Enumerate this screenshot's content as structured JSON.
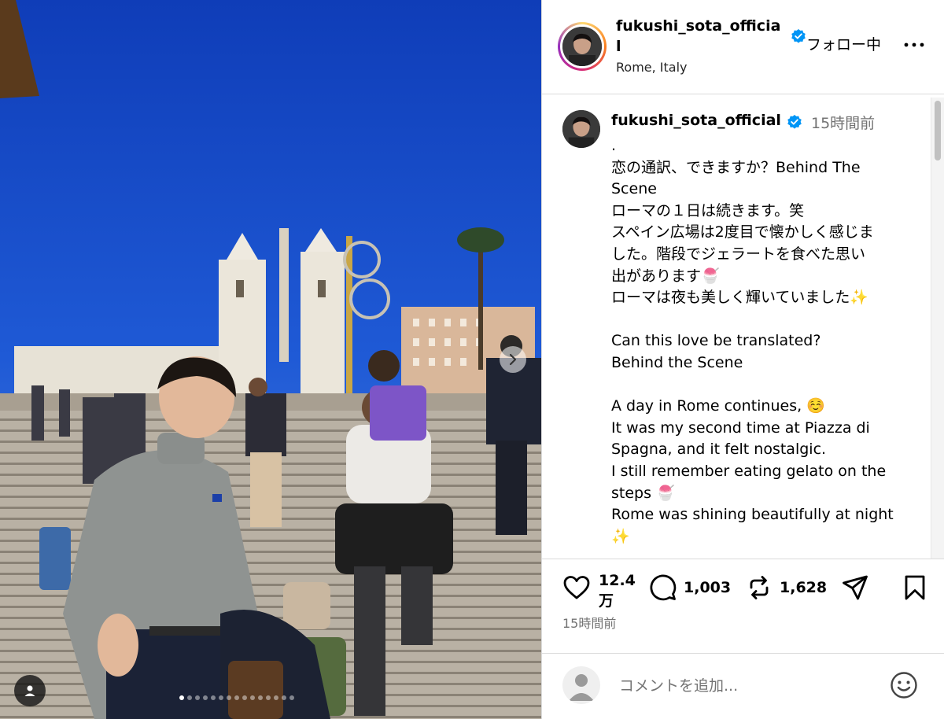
{
  "post": {
    "username": "fukushi_sota_official",
    "username_wrapped": "fukushi_sota_officia l",
    "follow_state": "フォロー中",
    "location": "Rome, Italy",
    "more_label": "•••"
  },
  "caption": {
    "username": "fukushi_sota_official",
    "time": "15時間前",
    "lines": [
      ".",
      "恋の通訳、できますか？Behind The",
      "Scene",
      "ローマの１日は続きます。笑",
      "スペイン広場は2度目で懐かしく感じま",
      "した。階段でジェラートを食べた思い",
      "出があります🍧",
      "ローマは夜も美しく輝いていました✨",
      "",
      "Can this love be translated?",
      "Behind the Scene",
      "",
      "A day in Rome continues, ☺️",
      "It was my second time at Piazza di",
      "Spagna, and it felt nostalgic.",
      "I still remember eating gelato on the",
      "steps 🍧",
      "Rome was shining beautifully at night",
      "✨"
    ]
  },
  "actions": {
    "likes": "12.4 万",
    "comments": "1,003",
    "reposts": "1,628",
    "post_time": "15時間前"
  },
  "comment": {
    "placeholder": "コメントを追加..."
  },
  "carousel": {
    "total_slides": 15,
    "active_index": 0
  },
  "colors": {
    "verified": "#0095f6",
    "muted_text": "#737373",
    "divider": "#dbdbdb",
    "sky": "#1847c9"
  },
  "icons": {
    "like": "heart-icon",
    "comment": "speech-bubble-icon",
    "repost": "repost-icon",
    "share": "paper-plane-icon",
    "save": "bookmark-icon",
    "next": "chevron-right-icon",
    "tag": "user-tag-icon",
    "emoji": "smiley-icon"
  }
}
